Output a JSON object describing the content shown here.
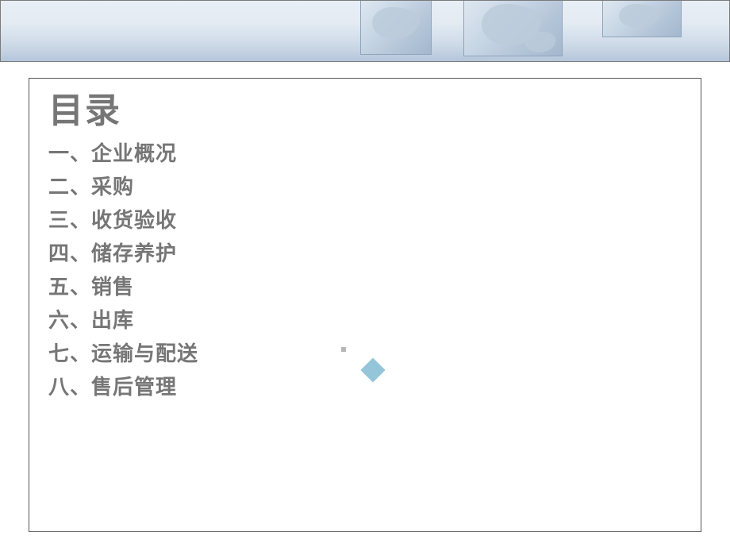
{
  "title": "目录",
  "toc": {
    "items": [
      {
        "label": "一、企业概况"
      },
      {
        "label": "二、采购"
      },
      {
        "label": "三、收货验收"
      },
      {
        "label": "四、储存养护"
      },
      {
        "label": "五、销售"
      },
      {
        "label": "六、出库"
      },
      {
        "label": "七、运输与配送"
      },
      {
        "label": "八、售后管理"
      }
    ]
  }
}
